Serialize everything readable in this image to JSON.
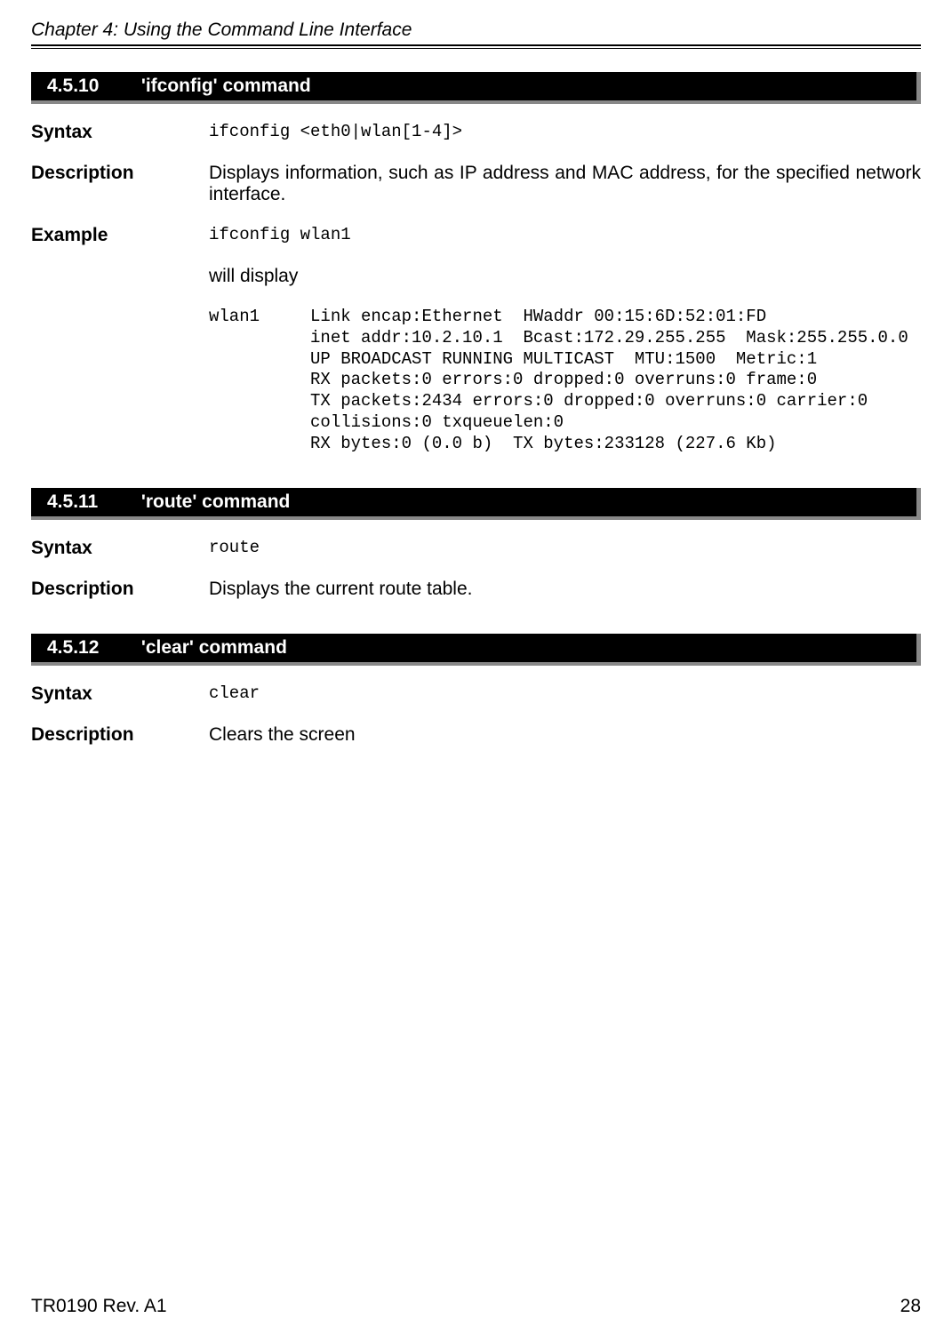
{
  "header": {
    "chapter": "Chapter 4: Using the Command Line Interface"
  },
  "sections": {
    "ifconfig": {
      "number": "4.5.10",
      "title": "'ifconfig' command",
      "syntax_label": "Syntax",
      "syntax": "ifconfig <eth0|wlan[1-4]>",
      "description_label": "Description",
      "description": "Displays information, such as IP address and MAC address, for the specified network interface.",
      "example_label": "Example",
      "example_cmd": "ifconfig wlan1",
      "will_display": "will display",
      "output": "wlan1     Link encap:Ethernet  HWaddr 00:15:6D:52:01:FD\n          inet addr:10.2.10.1  Bcast:172.29.255.255  Mask:255.255.0.0\n          UP BROADCAST RUNNING MULTICAST  MTU:1500  Metric:1\n          RX packets:0 errors:0 dropped:0 overruns:0 frame:0\n          TX packets:2434 errors:0 dropped:0 overruns:0 carrier:0\n          collisions:0 txqueuelen:0\n          RX bytes:0 (0.0 b)  TX bytes:233128 (227.6 Kb)"
    },
    "route": {
      "number": "4.5.11",
      "title": "'route' command",
      "syntax_label": "Syntax",
      "syntax": "route",
      "description_label": "Description",
      "description": "Displays the current route table."
    },
    "clear": {
      "number": "4.5.12",
      "title": "'clear' command",
      "syntax_label": "Syntax",
      "syntax": "clear",
      "description_label": "Description",
      "description": "Clears the screen"
    }
  },
  "footer": {
    "left": "TR0190 Rev. A1",
    "right": "28"
  }
}
